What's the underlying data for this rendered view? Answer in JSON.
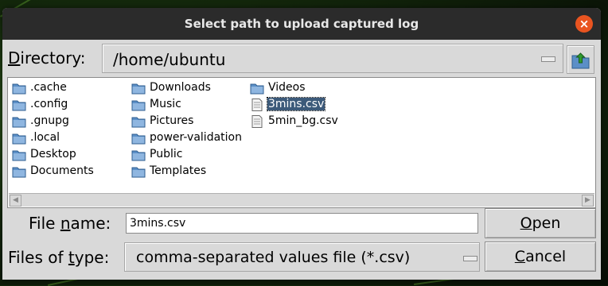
{
  "window": {
    "title": "Select path to upload captured log",
    "close_glyph": "×"
  },
  "directory": {
    "label_mnemonic": "D",
    "label_rest": "irectory:",
    "value": "/home/ubuntu"
  },
  "files": [
    {
      "name": ".cache",
      "type": "folder"
    },
    {
      "name": ".config",
      "type": "folder"
    },
    {
      "name": ".gnupg",
      "type": "folder"
    },
    {
      "name": ".local",
      "type": "folder"
    },
    {
      "name": "Desktop",
      "type": "folder"
    },
    {
      "name": "Documents",
      "type": "folder"
    },
    {
      "name": "Downloads",
      "type": "folder"
    },
    {
      "name": "Music",
      "type": "folder"
    },
    {
      "name": "Pictures",
      "type": "folder"
    },
    {
      "name": "power-validation",
      "type": "folder"
    },
    {
      "name": "Public",
      "type": "folder"
    },
    {
      "name": "Templates",
      "type": "folder"
    },
    {
      "name": "Videos",
      "type": "folder"
    },
    {
      "name": "3mins.csv",
      "type": "file",
      "selected": true
    },
    {
      "name": "5min_bg.csv",
      "type": "file"
    }
  ],
  "filename": {
    "label_pre": "File ",
    "label_mnemonic": "n",
    "label_post": "ame:",
    "value": "3mins.csv"
  },
  "filetype": {
    "label_pre": "Files of ",
    "label_mnemonic": "t",
    "label_post": "ype:",
    "value": "comma-separated values file (*.csv)"
  },
  "buttons": {
    "open": {
      "mnemonic": "O",
      "rest": "pen"
    },
    "cancel": {
      "mnemonic": "C",
      "rest": "ancel"
    }
  },
  "colors": {
    "titlebar": "#2b2b2b",
    "close": "#e95420",
    "selection": "#3c5a7a",
    "folder": "#5b8fc7",
    "dialog": "#d9d9d9"
  },
  "icons": {
    "folder": "folder-icon",
    "file": "file-icon",
    "up": "folder-up-icon"
  }
}
